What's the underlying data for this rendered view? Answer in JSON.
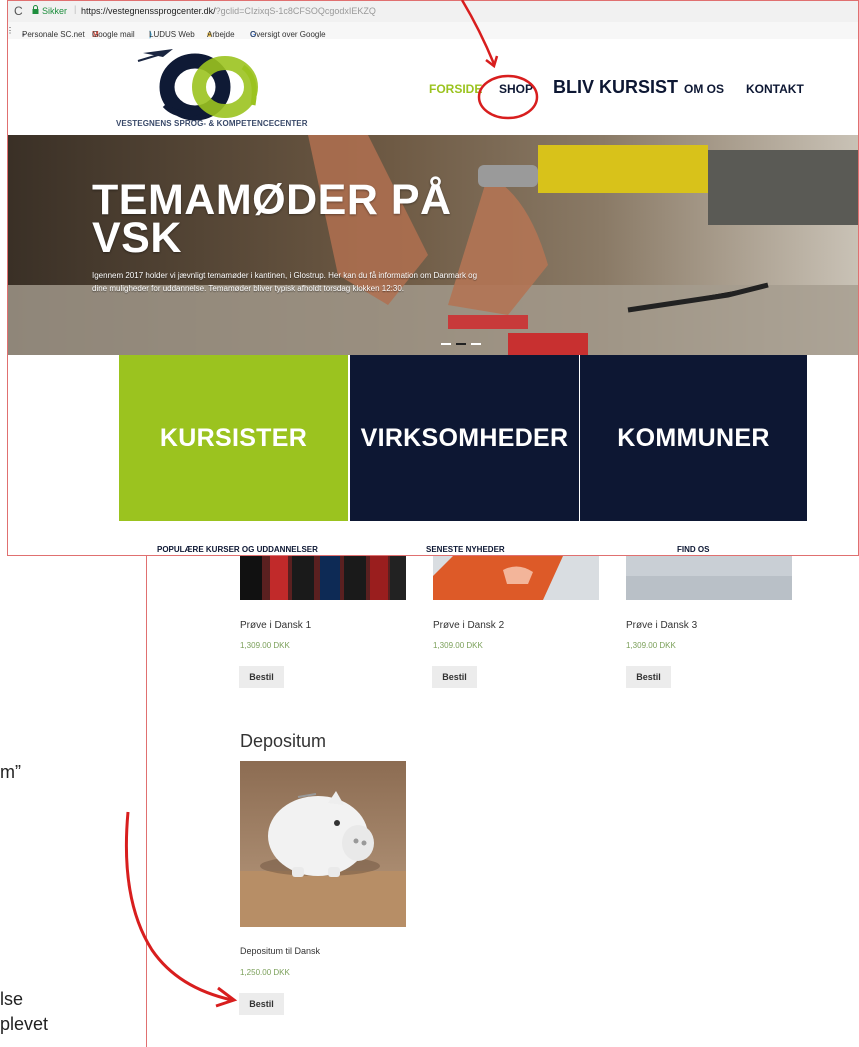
{
  "browser": {
    "reload_glyph": "C",
    "secure_label": "Sikker",
    "separator": "|",
    "url_main": "https://vestegnenssprogcenter.dk/",
    "url_query": "?gclid=CIzixqS-1c8CFSOQcgodxIEKZQ",
    "bookmarks": [
      {
        "label": "Personale SC.net",
        "icon": "doc-icon"
      },
      {
        "label": "Google mail",
        "icon": "gmail-icon"
      },
      {
        "label": "LUDUS Web",
        "icon": "ludus-icon"
      },
      {
        "label": "Arbejde",
        "icon": "folder-icon"
      },
      {
        "label": "Oversigt over Google",
        "icon": "google-icon"
      }
    ]
  },
  "site": {
    "logo_text": "VESTEGNENS SPROG- & KOMPETENCECENTER",
    "nav": {
      "forside": "FORSIDE",
      "shop": "SHOP",
      "bliv_kursist": "BLIV KURSIST",
      "om_os": "OM OS",
      "kontakt": "KONTAKT"
    },
    "hero": {
      "title_line1": "TEMAMØDER PÅ",
      "title_line2": "VSK",
      "text": "Igennem 2017 holder vi jævnligt temamøder i kantinen, i Glostrup. Her kan du få information om Danmark og dine muligheder for uddannelse. Temamøder bliver typisk afholdt torsdag klokken 12:30."
    },
    "tiles": {
      "kursister": "KURSISTER",
      "virksomheder": "VIRKSOMHEDER",
      "kommuner": "KOMMUNER"
    },
    "sections": {
      "popular": "POPULÆRE KURSER OG UDDANNELSER",
      "news": "SENESTE NYHEDER",
      "find": "FIND OS"
    }
  },
  "shop": {
    "products": [
      {
        "name": "Prøve i Dansk 1",
        "price": "1,309.00 DKK",
        "button": "Bestil"
      },
      {
        "name": "Prøve i Dansk 2",
        "price": "1,309.00 DKK",
        "button": "Bestil"
      },
      {
        "name": "Prøve i Dansk 3",
        "price": "1,309.00 DKK",
        "button": "Bestil"
      }
    ],
    "category_title": "Depositum",
    "deposit": {
      "name": "Depositum til Dansk",
      "price": "1,250.00 DKK",
      "button": "Bestil"
    }
  },
  "fragments": {
    "depositum_quote": "m”",
    "else": "lse",
    "plevet": "plevet"
  },
  "colors": {
    "green": "#9bc31f",
    "navy": "#0d1733",
    "annotation_red": "#d81e1e",
    "price_green": "#7ba05a"
  }
}
